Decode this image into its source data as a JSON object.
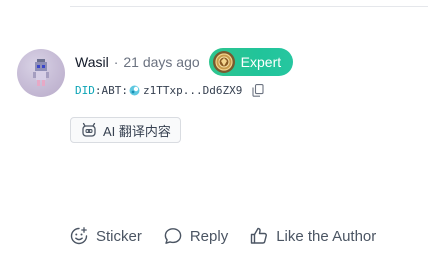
{
  "comment": {
    "author": {
      "name": "Wasil",
      "avatar_icon": "pixel-robot-avatar"
    },
    "separator": "·",
    "time": "21 days ago",
    "badge": {
      "label": "Expert",
      "icon": "expert-medal-icon",
      "color": "#2fc58f"
    },
    "did": {
      "prefix": "DID",
      "colon": ":",
      "chain": "ABT:",
      "logo": "abt-logo-icon",
      "value": "z1TTxp...Dd6ZX9"
    },
    "translate": {
      "label": "AI 翻译内容"
    }
  },
  "actions": {
    "sticker": "Sticker",
    "reply": "Reply",
    "like": "Like the Author"
  }
}
